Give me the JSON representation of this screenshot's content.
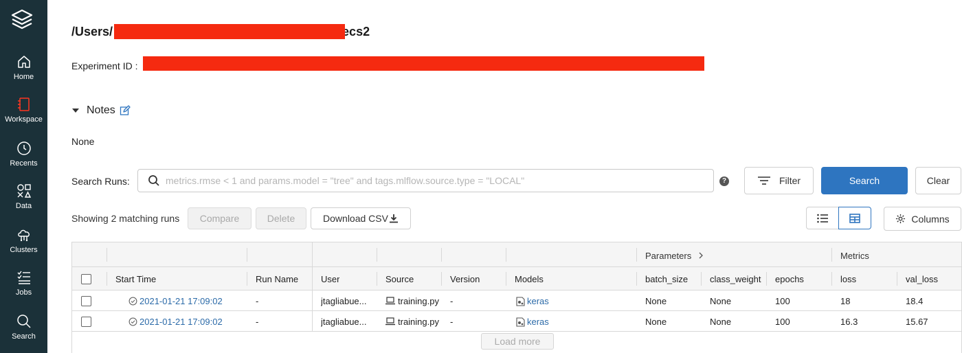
{
  "sidebar": {
    "items": [
      {
        "label": "Home",
        "icon": "home-icon"
      },
      {
        "label": "Workspace",
        "icon": "workspace-icon"
      },
      {
        "label": "Recents",
        "icon": "clock-icon"
      },
      {
        "label": "Data",
        "icon": "data-icon"
      },
      {
        "label": "Clusters",
        "icon": "cloud-icon"
      },
      {
        "label": "Jobs",
        "icon": "jobs-icon"
      },
      {
        "label": "Search",
        "icon": "search-icon"
      }
    ]
  },
  "header": {
    "title_prefix": "/Users/",
    "title_suffix": "ecs2",
    "experiment_label": "Experiment ID :"
  },
  "notes": {
    "label": "Notes",
    "content": "None"
  },
  "search": {
    "label": "Search Runs:",
    "placeholder": "metrics.rmse < 1 and params.model = \"tree\" and tags.mlflow.source.type = \"LOCAL\"",
    "help": "?",
    "filter_label": "Filter",
    "search_label": "Search",
    "clear_label": "Clear"
  },
  "toolbar": {
    "showing": "Showing 2 matching runs",
    "compare": "Compare",
    "delete": "Delete",
    "download": "Download CSV",
    "columns": "Columns"
  },
  "table": {
    "groups": {
      "parameters": "Parameters",
      "metrics": "Metrics"
    },
    "headers": [
      "Start Time",
      "Run Name",
      "User",
      "Source",
      "Version",
      "Models",
      "batch_size",
      "class_weight",
      "epochs",
      "loss",
      "val_loss"
    ],
    "rows": [
      {
        "start_time": "2021-01-21 17:09:02",
        "run_name": "-",
        "user": "jtagliabue...",
        "source": "training.py",
        "version": "-",
        "model": "keras",
        "batch_size": "None",
        "class_weight": "None",
        "epochs": "100",
        "loss": "18",
        "val_loss": "18.4"
      },
      {
        "start_time": "2021-01-21 17:09:02",
        "run_name": "-",
        "user": "jtagliabue...",
        "source": "training.py",
        "version": "-",
        "model": "keras",
        "batch_size": "None",
        "class_weight": "None",
        "epochs": "100",
        "loss": "16.3",
        "val_loss": "15.67"
      }
    ],
    "load_more": "Load more"
  },
  "colors": {
    "sidebar_bg": "#1b3139",
    "primary": "#2e75c0",
    "link": "#2b6aa8",
    "redaction": "#f52a10"
  }
}
